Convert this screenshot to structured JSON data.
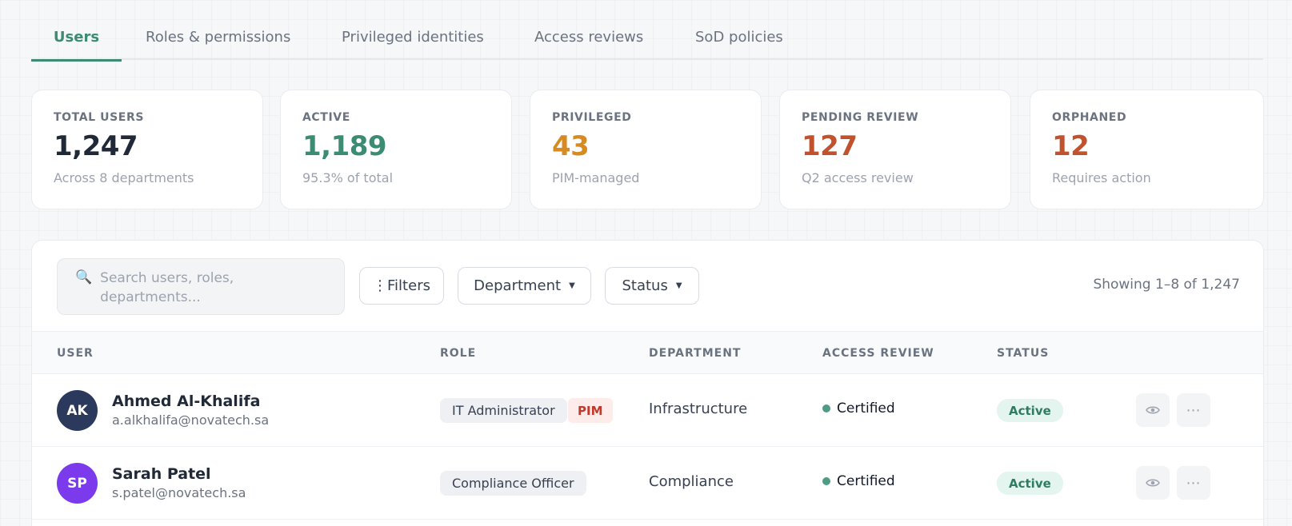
{
  "tabs": [
    {
      "label": "Users",
      "active": true
    },
    {
      "label": "Roles & permissions"
    },
    {
      "label": "Privileged identities"
    },
    {
      "label": "Access reviews"
    },
    {
      "label": "SoD policies"
    }
  ],
  "stats": [
    {
      "label": "TOTAL USERS",
      "value": "1,247",
      "sub": "Across 8 departments",
      "color": "#1f2937"
    },
    {
      "label": "ACTIVE",
      "value": "1,189",
      "sub": "95.3% of total",
      "color": "#3c8b73"
    },
    {
      "label": "PRIVILEGED",
      "value": "43",
      "sub": "PIM-managed",
      "color": "#d68a1f"
    },
    {
      "label": "PENDING REVIEW",
      "value": "127",
      "sub": "Q2 access review",
      "color": "#c0522e"
    },
    {
      "label": "ORPHANED",
      "value": "12",
      "sub": "Requires action",
      "color": "#c0522e"
    }
  ],
  "toolbar": {
    "search_placeholder": "Search users, roles, departments...",
    "filters_label": "⋮Filters",
    "department_label": "Department",
    "status_label": "Status",
    "showing": "Showing 1–8 of 1,247"
  },
  "table": {
    "headers": {
      "user": "USER",
      "role": "ROLE",
      "department": "DEPARTMENT",
      "review": "ACCESS REVIEW",
      "status": "STATUS"
    },
    "rows": [
      {
        "initials": "AK",
        "avatar_color": "#2b3a5c",
        "name": "Ahmed Al-Khalifa",
        "email": "a.alkhalifa@novatech.sa",
        "role": "IT Administrator",
        "badge": "PIM",
        "department": "Infrastructure",
        "review": "Certified",
        "status": "Active"
      },
      {
        "initials": "SP",
        "avatar_color": "#7c3aed",
        "name": "Sarah Patel",
        "email": "s.patel@novatech.sa",
        "role": "Compliance Officer",
        "badge": "",
        "department": "Compliance",
        "review": "Certified",
        "status": "Active"
      }
    ]
  }
}
